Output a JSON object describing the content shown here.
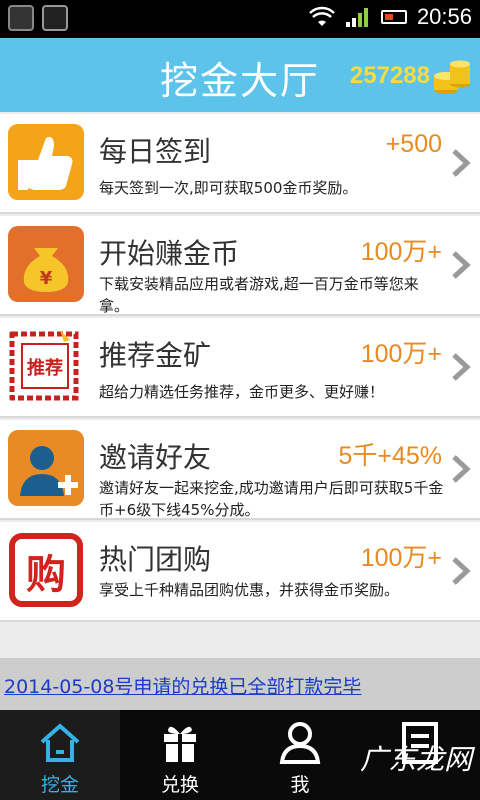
{
  "status_bar": {
    "time": "20:56"
  },
  "header": {
    "title": "挖金大厅",
    "gold_count": "257288"
  },
  "tasks": [
    {
      "title": "每日签到",
      "reward": "+500",
      "desc": "每天签到一次,即可获取500金币奖励。",
      "icon": "thumbs-up-icon"
    },
    {
      "title": "开始赚金币",
      "reward": "100万+",
      "desc": "下载安装精品应用或者游戏,超一百万金币等您来拿。",
      "icon": "money-bag-icon"
    },
    {
      "title": "推荐金矿",
      "reward": "100万+",
      "desc": "超给力精选任务推荐，金币更多、更好赚！",
      "icon": "recommend-stamp-icon",
      "icon_text": "推荐"
    },
    {
      "title": "邀请好友",
      "reward": "5千+45%",
      "desc": "邀请好友一起来挖金,成功邀请用户后即可获取5千金币+6级下线45%分成。",
      "icon": "add-user-icon"
    },
    {
      "title": "热门团购",
      "reward": "100万+",
      "desc": "享受上千种精品团购优惠，并获得金币奖励。",
      "icon": "group-buy-seal-icon",
      "icon_text": "购"
    }
  ],
  "notice": {
    "text": "2014-05-08号申请的兑换已全部打款完毕"
  },
  "tabs": [
    {
      "label": "挖金",
      "icon": "home-icon",
      "active": true
    },
    {
      "label": "兑换",
      "icon": "gift-icon",
      "active": false
    },
    {
      "label": "我",
      "icon": "person-icon",
      "active": false
    },
    {
      "label": "",
      "icon": "list-icon",
      "active": false
    }
  ],
  "watermark": "广东龙网",
  "colors": {
    "header_bg": "#5ec3ea",
    "reward": "#e88a1f",
    "gold": "#f6dc3e",
    "tab_active": "#36b3e6",
    "link": "#1a3cc4"
  }
}
